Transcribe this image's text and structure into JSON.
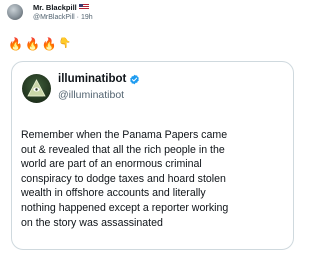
{
  "post": {
    "author_name": "Mr. Blackpill",
    "author_handle": "@MrBlackPill",
    "separator": " · ",
    "timestamp": "19h",
    "emojis": [
      "🔥",
      "🔥",
      "🔥",
      "👇"
    ]
  },
  "quoted": {
    "author_name": "illuminatibot",
    "author_handle": "@illuminatibot",
    "verified": true,
    "accent_color": "#1d9bf0",
    "text_lines": [
      "Remember when the Panama Papers came",
      "out & revealed that all the rich people in the",
      "world are part of an enormous criminal",
      "conspiracy to dodge taxes and hoard stolen",
      "wealth in offshore accounts and literally",
      "nothing happened except a reporter working",
      "on the story was assassinated"
    ]
  },
  "icons": {
    "avatar_small": "user-avatar",
    "avatar_quote": "eye-pyramid-logo",
    "flag": "us-flag-icon",
    "verified": "verified-badge-icon"
  }
}
